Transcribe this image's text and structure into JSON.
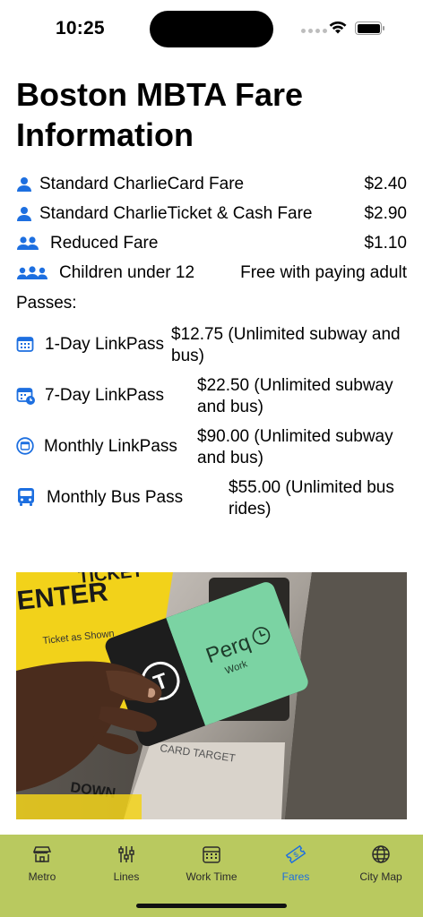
{
  "status": {
    "time": "10:25"
  },
  "title": "Boston MBTA Fare Information",
  "fares": [
    {
      "icon": "person-icon",
      "label": "Standard CharlieCard Fare",
      "price": "$2.40"
    },
    {
      "icon": "person-icon",
      "label": "Standard CharlieTicket & Cash Fare",
      "price": "$2.90"
    },
    {
      "icon": "two-people-icon",
      "label": "Reduced Fare",
      "price": "$1.10"
    },
    {
      "icon": "three-people-icon",
      "label": "Children under 12",
      "price": "Free with paying adult"
    }
  ],
  "passes_heading": "Passes:",
  "passes": [
    {
      "icon": "calendar-icon",
      "label": "1-Day LinkPass",
      "price": "$12.75 (Unlimited subway and bus)"
    },
    {
      "icon": "calendar-clock-icon",
      "label": "7-Day LinkPass",
      "price": "$22.50 (Unlimited subway and bus)"
    },
    {
      "icon": "calendar-circle-icon",
      "label": "Monthly LinkPass",
      "price": "$90.00 (Unlimited subway and bus)"
    },
    {
      "icon": "bus-icon",
      "label": "Monthly Bus Pass",
      "price": "$55.00 (Unlimited bus rides)"
    }
  ],
  "photo": {
    "machine_text": "ENTER",
    "machine_text_2": "TICKET",
    "card_brand": "Perq",
    "card_sub": "Work",
    "target_text": "CARD TARGET",
    "small_text": "Ticket as Shown",
    "bottom_text": "DOWN"
  },
  "tabs": [
    {
      "label": "Metro",
      "icon": "storefront-icon"
    },
    {
      "label": "Lines",
      "icon": "sliders-icon"
    },
    {
      "label": "Work Time",
      "icon": "calendar-icon"
    },
    {
      "label": "Fares",
      "icon": "ticket-icon",
      "active": true
    },
    {
      "label": "City Map",
      "icon": "globe-icon"
    }
  ],
  "colors": {
    "accent": "#1d6fe0",
    "tabbar": "#b9c95f",
    "card_green": "#7bd3a3"
  }
}
